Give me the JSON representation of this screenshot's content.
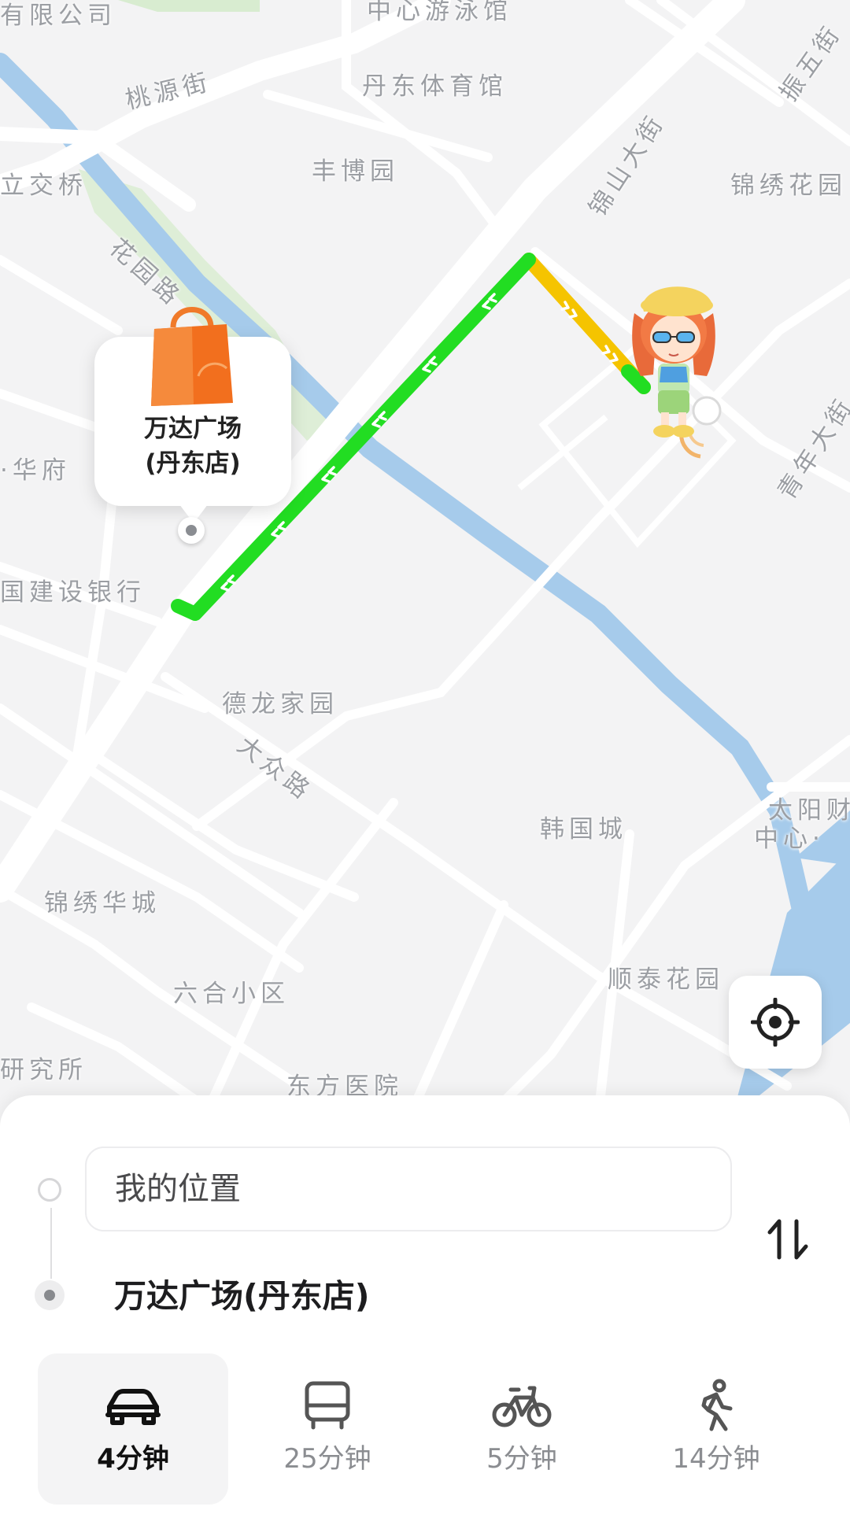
{
  "map": {
    "labels": {
      "l1": "有限公司",
      "l2": "中心游泳馆",
      "l3": "桃源街",
      "l4": "丹东体育馆",
      "l5": "振五街",
      "l6": "立交桥",
      "l7": "丰博园",
      "l8": "锦山大街",
      "l9": "锦绣花园",
      "l10": "花园路",
      "l11": "·华府",
      "l12": "青年大街",
      "l13": "国建设银行",
      "l14": "德龙家园",
      "l15": "大众路",
      "l16": "韩国城",
      "l17": "太阳财",
      "l18": "中心·",
      "l19": "锦绣华城",
      "l20": "六合小区",
      "l21": "顺泰花园",
      "l22": "研究所",
      "l23": "东方医院"
    },
    "destination_card": {
      "name_line1": "万达广场",
      "name_line2": "(丹东店)"
    },
    "route_colors": {
      "smooth": "#22dd22",
      "slow": "#f5c400"
    },
    "water_color": "#a6cbeb",
    "park_color": "#d8ecd0"
  },
  "panel": {
    "origin_placeholder": "我的位置",
    "destination": "万达广场(丹东店)",
    "swap_icon": "swap-vertical-icon",
    "modes": [
      {
        "icon": "car-icon",
        "label": "4分钟",
        "active": true
      },
      {
        "icon": "bus-icon",
        "label": "25分钟",
        "active": false
      },
      {
        "icon": "bike-icon",
        "label": "5分钟",
        "active": false
      },
      {
        "icon": "walk-icon",
        "label": "14分钟",
        "active": false
      }
    ]
  }
}
